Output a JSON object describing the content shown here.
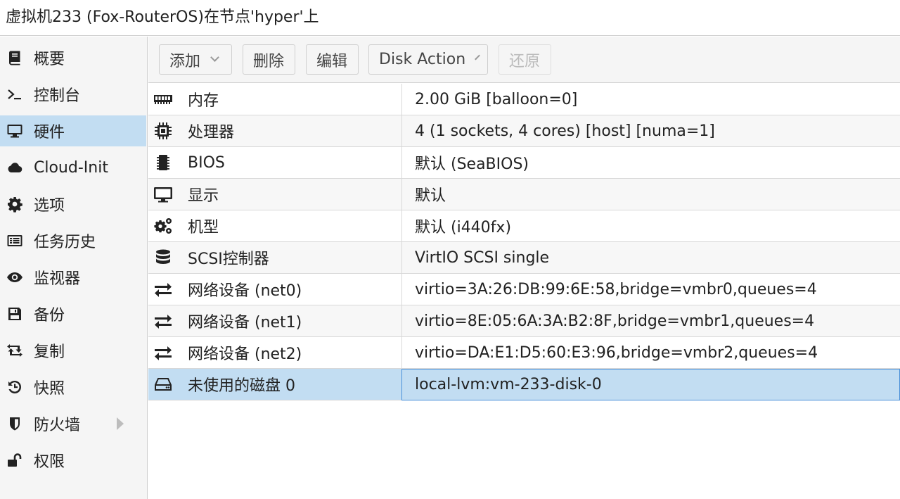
{
  "window": {
    "title": "虚拟机233 (Fox-RouterOS)在节点'hyper'上"
  },
  "sidebar": {
    "items": [
      {
        "label": "概要",
        "icon": "book-icon"
      },
      {
        "label": "控制台",
        "icon": "terminal-icon"
      },
      {
        "label": "硬件",
        "icon": "monitor-icon",
        "selected": true
      },
      {
        "label": "Cloud-Init",
        "icon": "cloud-icon"
      },
      {
        "label": "选项",
        "icon": "gear-icon"
      },
      {
        "label": "任务历史",
        "icon": "list-icon"
      },
      {
        "label": "监视器",
        "icon": "eye-icon"
      },
      {
        "label": "备份",
        "icon": "floppy-icon"
      },
      {
        "label": "复制",
        "icon": "retweet-icon"
      },
      {
        "label": "快照",
        "icon": "history-icon"
      },
      {
        "label": "防火墙",
        "icon": "shield-icon",
        "has_submenu": true
      },
      {
        "label": "权限",
        "icon": "unlock-icon"
      }
    ]
  },
  "toolbar": {
    "add_label": "添加",
    "remove_label": "删除",
    "edit_label": "编辑",
    "disk_action_label": "Disk Action",
    "revert_label": "还原"
  },
  "hardware": {
    "rows": [
      {
        "name": "内存",
        "value": "2.00 GiB [balloon=0]",
        "icon": "memory-icon"
      },
      {
        "name": "处理器",
        "value": "4 (1 sockets, 4 cores) [host] [numa=1]",
        "icon": "cpu-icon"
      },
      {
        "name": "BIOS",
        "value": "默认 (SeaBIOS)",
        "icon": "chip-icon"
      },
      {
        "name": "显示",
        "value": "默认",
        "icon": "desktop-icon"
      },
      {
        "name": "机型",
        "value": "默认 (i440fx)",
        "icon": "cogs-icon"
      },
      {
        "name": "SCSI控制器",
        "value": "VirtIO SCSI single",
        "icon": "database-icon"
      },
      {
        "name": "网络设备 (net0)",
        "value": "virtio=3A:26:DB:99:6E:58,bridge=vmbr0,queues=4",
        "icon": "exchange-icon"
      },
      {
        "name": "网络设备 (net1)",
        "value": "virtio=8E:05:6A:3A:B2:8F,bridge=vmbr1,queues=4",
        "icon": "exchange-icon"
      },
      {
        "name": "网络设备 (net2)",
        "value": "virtio=DA:E1:D5:60:E3:96,bridge=vmbr2,queues=4",
        "icon": "exchange-icon"
      },
      {
        "name": "未使用的磁盘 0",
        "value": "local-lvm:vm-233-disk-0",
        "icon": "hdd-icon",
        "selected": true
      }
    ]
  },
  "colors": {
    "selection": "#c2ddf2",
    "selection_border": "#4a90d9",
    "panel_bg": "#f5f5f5"
  }
}
